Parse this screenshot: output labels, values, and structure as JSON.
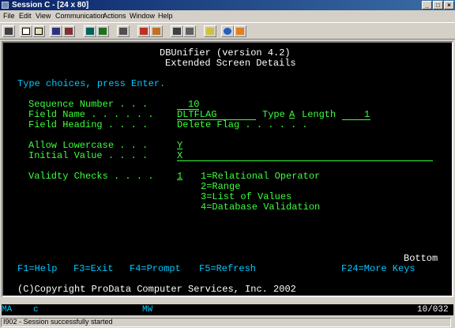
{
  "window": {
    "title": "Session C - [24 x 80]",
    "minimize": "_",
    "maximize": "□",
    "close": "×"
  },
  "menu": [
    "File",
    "Edit",
    "View",
    "Communication",
    "Actions",
    "Window",
    "Help"
  ],
  "toolbar_icons": [
    "print-screen-icon",
    "copy-icon",
    "paste-icon",
    "send-icon",
    "receive-icon",
    "display-icon",
    "color-icon",
    "keyboard-icon",
    "record-macro-icon",
    "play-macro-icon",
    "stop-macro-icon",
    "customize-icon",
    "cancel-icon",
    "clipboard-icon",
    "globe-icon",
    "edit-icon"
  ],
  "screen": {
    "app_title": "DBUnifier (version 4.2)",
    "subtitle": "Extended Screen Details",
    "instruction": "Type choices, press Enter.",
    "fields": {
      "sequence_label": "Sequence Number . . .",
      "sequence_value": "10",
      "field_name_label": "Field Name . . . . . .",
      "field_name_value": "DLTFLAG",
      "type_label": "Type",
      "type_value": "A",
      "length_label": "Length",
      "length_value": "1",
      "heading_label": "Field Heading . . . .",
      "heading_value": "Delete Flag . . . . . .",
      "lowercase_label": "Allow Lowercase . . .",
      "lowercase_value": "Y",
      "initial_label": "Initial Value . . . .",
      "initial_value": "X",
      "validity_label": "Validty Checks . . . .",
      "validity_value": "1"
    },
    "validity_options": [
      "1=Relational Operator",
      "2=Range",
      "3=List of Values",
      "4=Database Validation"
    ],
    "bottom_indicator": "Bottom",
    "fkeys": {
      "f1": "F1=Help",
      "f3": "F3=Exit",
      "f4": "F4=Prompt",
      "f5": "F5=Refresh",
      "f24": "F24=More Keys"
    },
    "copyright": "(C)Copyright ProData Computer Services, Inc. 2002"
  },
  "oia": {
    "ma": "MA",
    "session": "c",
    "mw": "MW",
    "cursor": "10/032"
  },
  "status_message": "I902 - Session successfully started"
}
